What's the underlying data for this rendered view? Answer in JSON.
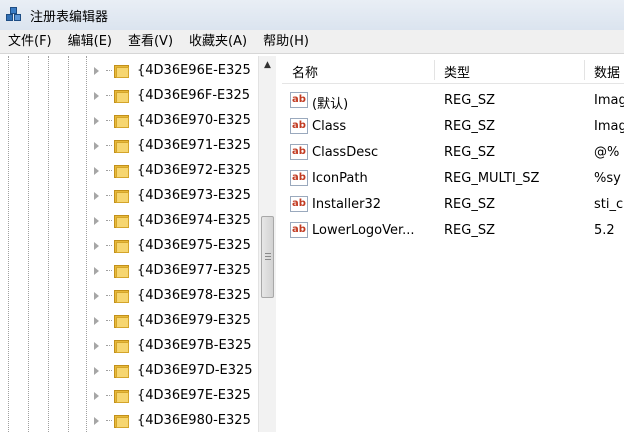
{
  "window": {
    "title": "注册表编辑器"
  },
  "menu": [
    {
      "label": "文件(F)"
    },
    {
      "label": "编辑(E)"
    },
    {
      "label": "查看(V)"
    },
    {
      "label": "收藏夹(A)"
    },
    {
      "label": "帮助(H)"
    }
  ],
  "tree": {
    "items": [
      {
        "label": "{4D36E96E-E325"
      },
      {
        "label": "{4D36E96F-E325"
      },
      {
        "label": "{4D36E970-E325"
      },
      {
        "label": "{4D36E971-E325"
      },
      {
        "label": "{4D36E972-E325"
      },
      {
        "label": "{4D36E973-E325"
      },
      {
        "label": "{4D36E974-E325"
      },
      {
        "label": "{4D36E975-E325"
      },
      {
        "label": "{4D36E977-E325"
      },
      {
        "label": "{4D36E978-E325"
      },
      {
        "label": "{4D36E979-E325"
      },
      {
        "label": "{4D36E97B-E325"
      },
      {
        "label": "{4D36E97D-E325"
      },
      {
        "label": "{4D36E97E-E325"
      },
      {
        "label": "{4D36E980-E325"
      }
    ]
  },
  "list": {
    "columns": {
      "name": "名称",
      "type": "类型",
      "data": "数据"
    },
    "icon_text": "ab",
    "rows": [
      {
        "name": "(默认)",
        "type": "REG_SZ",
        "data": "Imag"
      },
      {
        "name": "Class",
        "type": "REG_SZ",
        "data": "Imag"
      },
      {
        "name": "ClassDesc",
        "type": "REG_SZ",
        "data": "@%"
      },
      {
        "name": "IconPath",
        "type": "REG_MULTI_SZ",
        "data": "%sy"
      },
      {
        "name": "Installer32",
        "type": "REG_SZ",
        "data": "sti_c"
      },
      {
        "name": "LowerLogoVer...",
        "type": "REG_SZ",
        "data": "5.2"
      }
    ]
  }
}
